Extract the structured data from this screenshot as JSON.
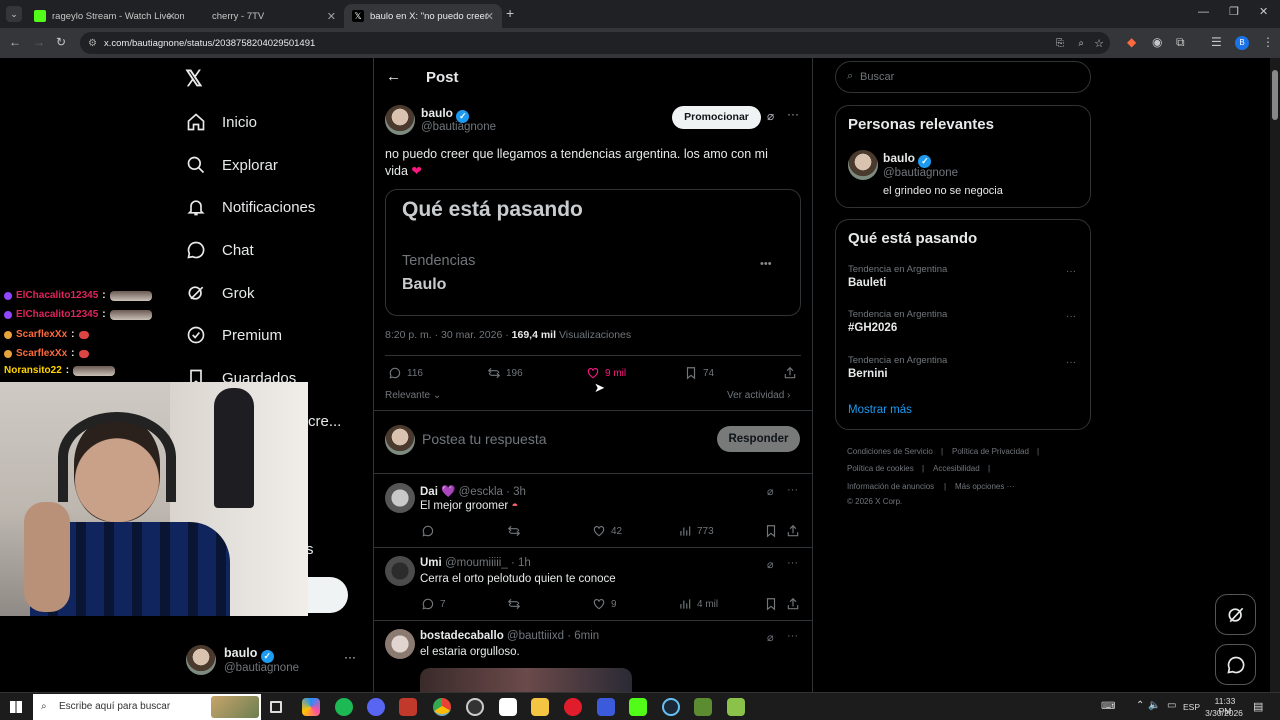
{
  "browser": {
    "tabs": [
      {
        "title": "rageylo Stream - Watch Live on"
      },
      {
        "title": "cherry - 7TV"
      },
      {
        "title": "baulo en X: \"no puedo creer qu"
      }
    ],
    "url": "x.com/bautiagnone/status/2038758204029501491"
  },
  "sidebar": {
    "items": [
      {
        "label": "Inicio"
      },
      {
        "label": "Explorar"
      },
      {
        "label": "Notificaciones"
      },
      {
        "label": "Chat"
      },
      {
        "label": "Grok"
      },
      {
        "label": "Premium"
      },
      {
        "label": "Guardados"
      },
      {
        "label": "cre..."
      },
      {
        "label": "s"
      }
    ],
    "account": {
      "name": "baulo",
      "handle": "@bautiagnone"
    }
  },
  "header": {
    "title": "Post"
  },
  "post": {
    "author_name": "baulo",
    "author_handle": "@bautiagnone",
    "promote_label": "Promocionar",
    "text": "no puedo creer que llegamos a tendencias argentina. los amo con mi vida",
    "image": {
      "heading": "Qué está pasando",
      "kicker": "Tendencias",
      "trend": "Baulo",
      "dots": "•••"
    },
    "meta_time": "8:20 p. m. · 30 mar. 2026 ·",
    "meta_views_count": "169,4 mil",
    "meta_views_label": "Visualizaciones",
    "actions": {
      "replies": "116",
      "reposts": "196",
      "likes": "9 mil",
      "bookmarks": "74"
    },
    "relevant_label": "Relevante",
    "activity_label": "Ver actividad",
    "reply_placeholder": "Postea tu respuesta",
    "reply_button": "Responder"
  },
  "replies": [
    {
      "name": "Dai 💜",
      "handle": "@esckla",
      "time": "· 3h",
      "text": "El mejor groomer",
      "replies": "",
      "reposts": "",
      "likes": "42",
      "views": "773"
    },
    {
      "name": "Umi",
      "handle": "@moumiiiii_",
      "time": "· 1h",
      "text": "Cerra el orto pelotudo quien te conoce",
      "replies": "7",
      "reposts": "",
      "likes": "9",
      "views": "4 mil"
    },
    {
      "name": "bostadecaballo",
      "handle": "@bauttiiixd",
      "time": "· 6min",
      "text": "el estaria orgulloso."
    }
  ],
  "search": {
    "placeholder": "Buscar"
  },
  "relevant_people": {
    "title": "Personas relevantes",
    "name": "baulo",
    "handle": "@bautiagnone",
    "bio": "el grindeo no se negocia"
  },
  "trends": {
    "title": "Qué está pasando",
    "items": [
      {
        "context": "Tendencia en Argentina",
        "name": "Bauleti"
      },
      {
        "context": "Tendencia en Argentina",
        "name": "#GH2026"
      },
      {
        "context": "Tendencia en Argentina",
        "name": "Bernini"
      }
    ],
    "more": "Mostrar más"
  },
  "footer": {
    "links": [
      "Condiciones de Servicio",
      "Política de Privacidad",
      "Política de cookies",
      "Accesibilidad",
      "Información de anuncios",
      "Más opciones ···"
    ],
    "copyright": "© 2026 X Corp."
  },
  "chat_overlay": [
    {
      "user": "ElChacalito12345",
      "sep": ":",
      "color": "#e0245e"
    },
    {
      "user": "ElChacalito12345",
      "sep": ":",
      "color": "#e0245e"
    },
    {
      "user": "ScarflexXx",
      "sep": ":",
      "color": "#ff6a3d"
    },
    {
      "user": "ScarflexXx",
      "sep": ":",
      "color": "#ff6a3d"
    },
    {
      "user": "Noransito22",
      "sep": ":",
      "color": "#ffd400"
    }
  ],
  "taskbar": {
    "search_placeholder": "Escribe aquí para buscar",
    "lang": "ESP",
    "time": "11:33 PM",
    "date": "3/30/2026"
  },
  "colors": {
    "accent": "#1d9bf0",
    "like": "#f91880",
    "bg": "#000000"
  }
}
